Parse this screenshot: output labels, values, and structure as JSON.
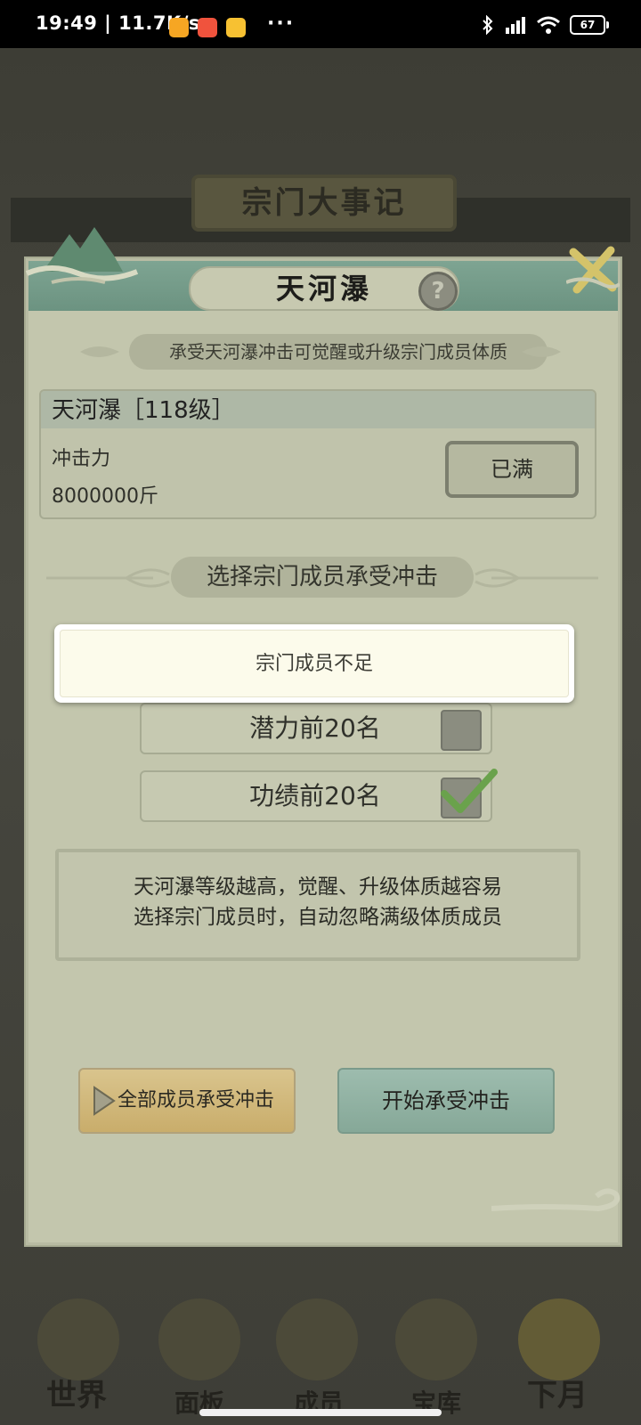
{
  "status_bar": {
    "time_speed": "19:49 | 11.7K/s",
    "more": "···",
    "battery": "67"
  },
  "background": {
    "title": "宗门大事记",
    "nav": [
      "世界",
      "面板",
      "成员",
      "宝库",
      "下月"
    ]
  },
  "dialog": {
    "title": "天河瀑",
    "help": "?",
    "banner": "承受天河瀑冲击可觉醒或升级宗门成员体质",
    "info": {
      "header": "天河瀑［118级］",
      "label": "冲击力",
      "value": "8000000斤",
      "full_button": "已满"
    },
    "select_banner": "选择宗门成员承受冲击",
    "options": [
      {
        "label": "潜力前20名",
        "checked": false
      },
      {
        "label": "功绩前20名",
        "checked": true
      }
    ],
    "notes": [
      "天河瀑等级越高，觉醒、升级体质越容易",
      "选择宗门成员时，自动忽略满级体质成员"
    ],
    "button_all": "全部成员承受冲击",
    "button_start": "开始承受冲击"
  },
  "toast": {
    "message": "宗门成员不足"
  }
}
